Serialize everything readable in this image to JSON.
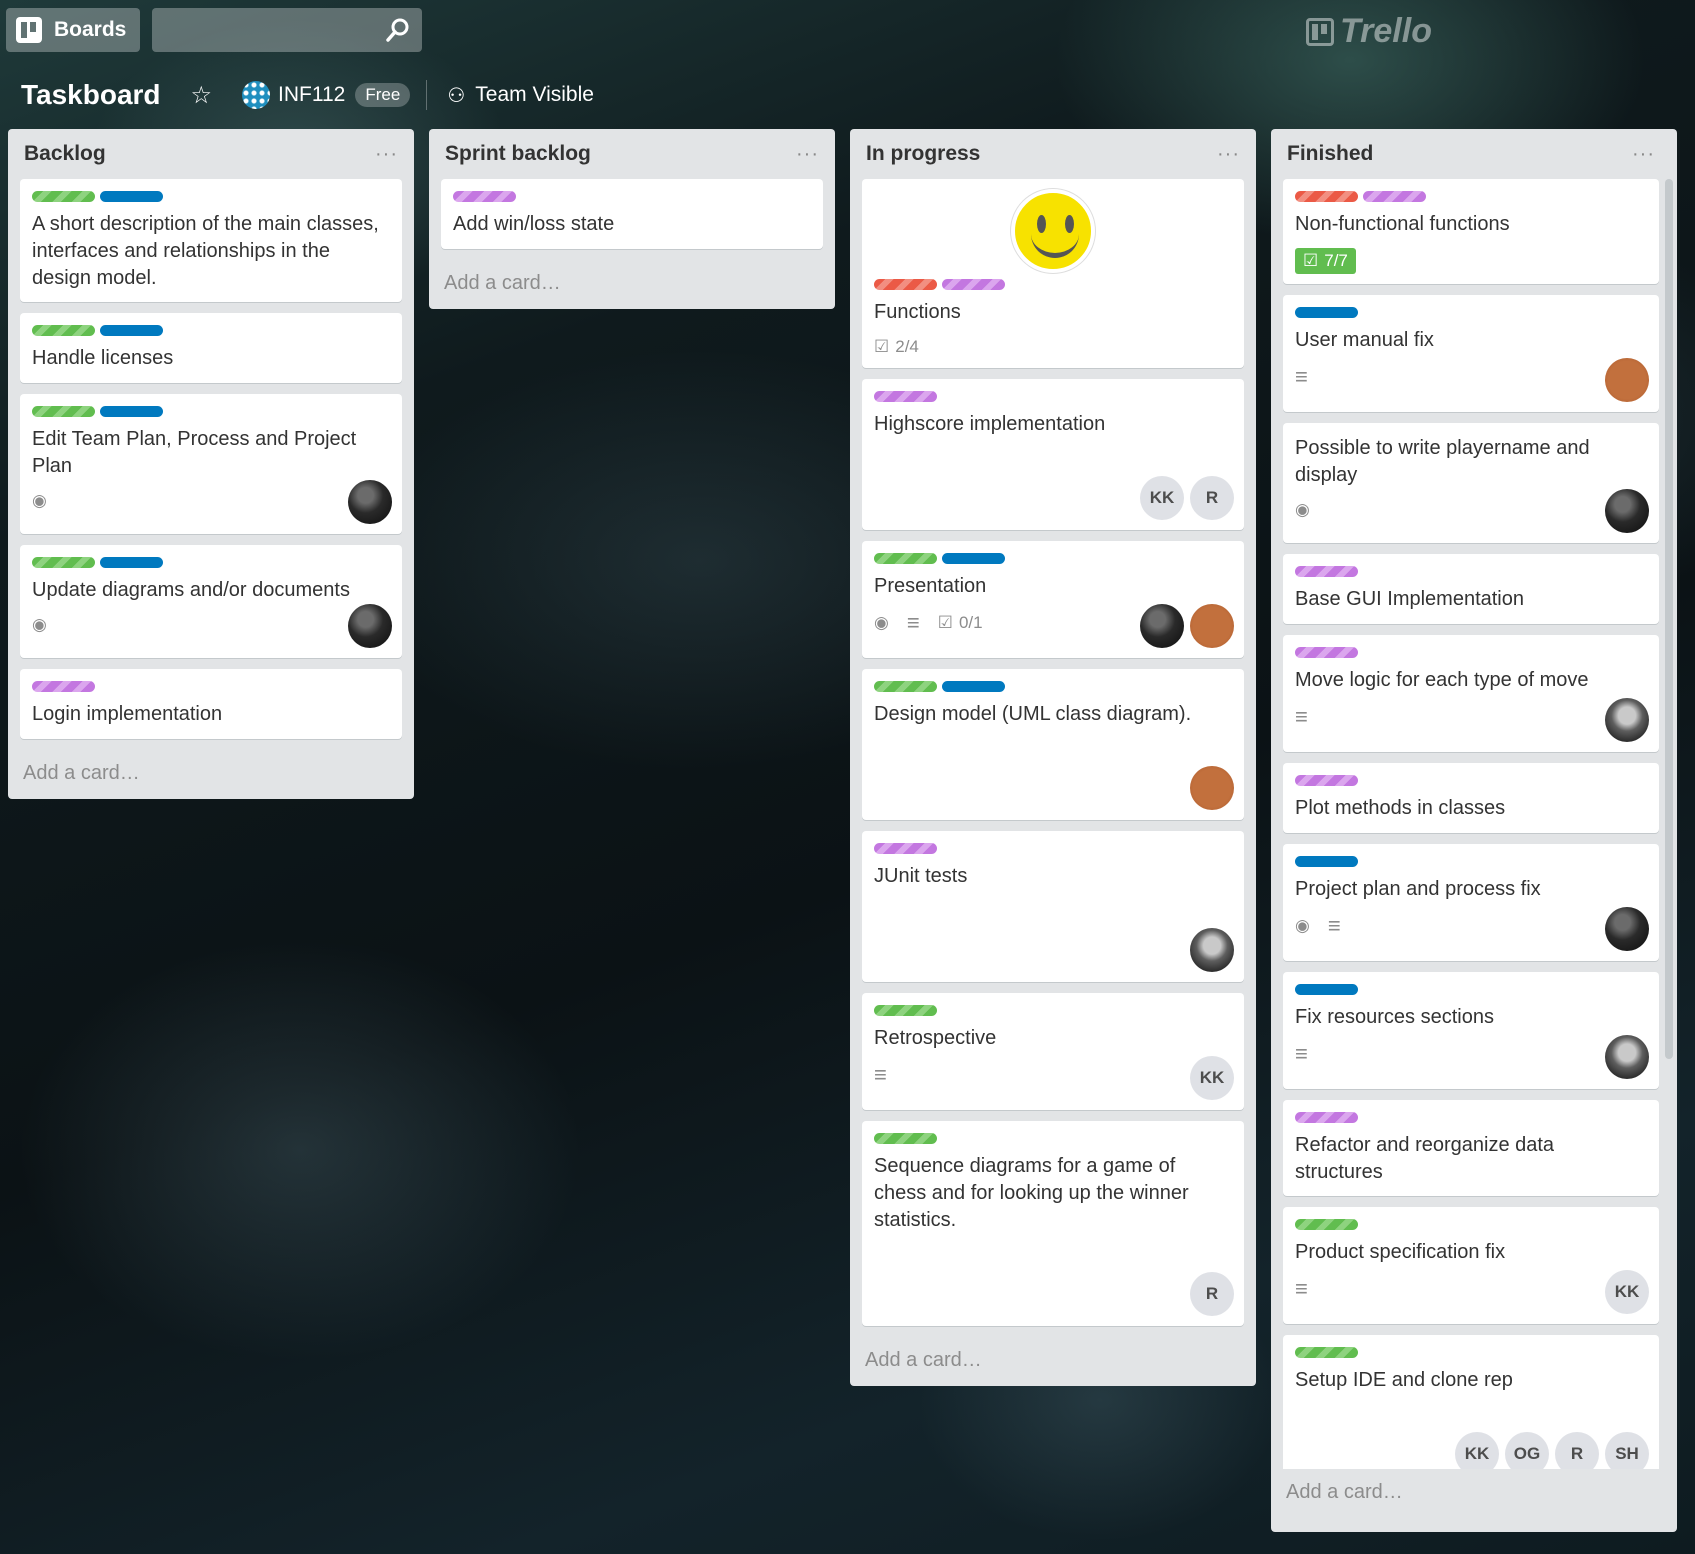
{
  "header": {
    "boards_label": "Boards",
    "search_placeholder": "",
    "logo_text": "Trello"
  },
  "board": {
    "title": "Taskboard",
    "team_name": "INF112",
    "plan_badge": "Free",
    "visibility": "Team Visible"
  },
  "lists": [
    {
      "title": "Backlog",
      "add_card": "Add a card…",
      "cards": [
        {
          "labels": [
            "green",
            "blue"
          ],
          "title": "A short description of the main classes, interfaces and relationships in the design model."
        },
        {
          "labels": [
            "green",
            "blue"
          ],
          "title": "Handle licenses"
        },
        {
          "labels": [
            "green",
            "blue"
          ],
          "title": "Edit Team Plan, Process and Project Plan",
          "watch": true,
          "members": [
            "dark"
          ]
        },
        {
          "labels": [
            "green",
            "blue"
          ],
          "title": "Update diagrams and/or documents",
          "watch": true,
          "members": [
            "dark"
          ]
        },
        {
          "labels": [
            "purple"
          ],
          "title": "Login implementation"
        }
      ]
    },
    {
      "title": "Sprint backlog",
      "add_card": "Add a card…",
      "cards": [
        {
          "labels": [
            "purple"
          ],
          "title": "Add win/loss state"
        }
      ]
    },
    {
      "title": "In progress",
      "add_card": "Add a card…",
      "cards": [
        {
          "cover": "smiley",
          "labels": [
            "red",
            "purple"
          ],
          "title": "Functions",
          "checklist": "2/4"
        },
        {
          "labels": [
            "purple"
          ],
          "title": "Highscore implementation",
          "members": [
            "KK",
            "R"
          ]
        },
        {
          "labels": [
            "green",
            "blue"
          ],
          "title": "Presentation",
          "watch": true,
          "description": true,
          "checklist": "0/1",
          "members": [
            "dark",
            "orange"
          ]
        },
        {
          "labels": [
            "green",
            "blue"
          ],
          "title": "Design model (UML class diagram).",
          "members": [
            "orange"
          ]
        },
        {
          "labels": [
            "purple"
          ],
          "title": "JUnit tests",
          "members": [
            "beard"
          ]
        },
        {
          "labels": [
            "green"
          ],
          "title": "Retrospective",
          "description": true,
          "members": [
            "KK"
          ]
        },
        {
          "labels": [
            "green"
          ],
          "title": "Sequence diagrams for a game of chess and for looking up the winner statistics.",
          "members": [
            "R"
          ]
        }
      ]
    },
    {
      "title": "Finished",
      "add_card": "Add a card…",
      "cards": [
        {
          "labels": [
            "red",
            "purple"
          ],
          "title": "Non-functional functions",
          "checklist_done": "7/7"
        },
        {
          "labels": [
            "blue"
          ],
          "title": "User manual fix",
          "description": true,
          "members": [
            "orange"
          ]
        },
        {
          "labels": [],
          "title": "Possible to write playername and display",
          "watch": true,
          "members": [
            "dark"
          ]
        },
        {
          "labels": [
            "purple"
          ],
          "title": "Base GUI Implementation"
        },
        {
          "labels": [
            "purple"
          ],
          "title": "Move logic for each type of move",
          "description": true,
          "members": [
            "beard"
          ]
        },
        {
          "labels": [
            "purple"
          ],
          "title": "Plot methods in classes"
        },
        {
          "labels": [
            "blue"
          ],
          "title": "Project plan and process fix",
          "watch": true,
          "description": true,
          "members": [
            "dark"
          ]
        },
        {
          "labels": [
            "blue"
          ],
          "title": "Fix resources sections",
          "description": true,
          "members": [
            "beard"
          ]
        },
        {
          "labels": [
            "purple"
          ],
          "title": "Refactor and reorganize data structures"
        },
        {
          "labels": [
            "green"
          ],
          "title": "Product specification fix",
          "description": true,
          "members": [
            "KK"
          ]
        },
        {
          "labels": [
            "green"
          ],
          "title": "Setup IDE and clone rep",
          "members": [
            "KK",
            "OG",
            "R",
            "SH"
          ]
        }
      ]
    }
  ],
  "icons": {
    "watch": "eye-icon",
    "description": "description-icon",
    "checklist": "checklist-icon",
    "star": "star-icon",
    "search": "search-icon"
  },
  "colors": {
    "label_green": "#61bd4f",
    "label_blue": "#0079bf",
    "label_purple": "#c377e0",
    "label_red": "#eb5a46",
    "list_bg": "#e2e4e6"
  }
}
